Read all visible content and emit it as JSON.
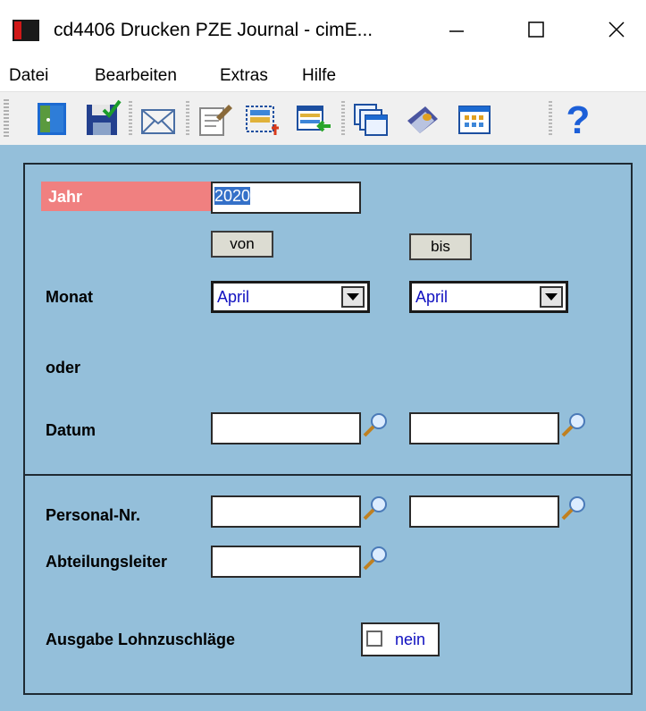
{
  "window": {
    "title": "cd4406 Drucken PZE Journal - cimE...",
    "minimize_glyph": "—",
    "maximize_glyph": "☐",
    "close_glyph": "✕"
  },
  "menu": [
    "Datei",
    "Bearbeiten",
    "Extras",
    "Hilfe"
  ],
  "toolbar": {
    "icons": [
      "exit-door-icon",
      "save-disk-icon",
      "mail-envelope-icon",
      "edit-note-icon",
      "new-record-icon",
      "import-list-icon",
      "copy-windows-icon",
      "book-icon",
      "calendar-grid-icon",
      "help-icon"
    ]
  },
  "form": {
    "jahr_label": "Jahr",
    "jahr_value": "2020",
    "von_label": "von",
    "bis_label": "bis",
    "monat_label": "Monat",
    "monat_von": "April",
    "monat_bis": "April",
    "oder_label": "oder",
    "datum_label": "Datum",
    "datum_von": "",
    "datum_bis": "",
    "personal_label": "Personal-Nr.",
    "personal_von": "",
    "personal_bis": "",
    "abteilung_label": "Abteilungsleiter",
    "abteilung_value": "",
    "ausgabe_label": "Ausgabe Lohnzuschläge",
    "ausgabe_checkbox_text": "nein"
  },
  "colors": {
    "content_bg": "#94bfda",
    "jahr_label_bg": "#f08080",
    "selection": "#3470c8",
    "value_text": "#1010c0"
  }
}
